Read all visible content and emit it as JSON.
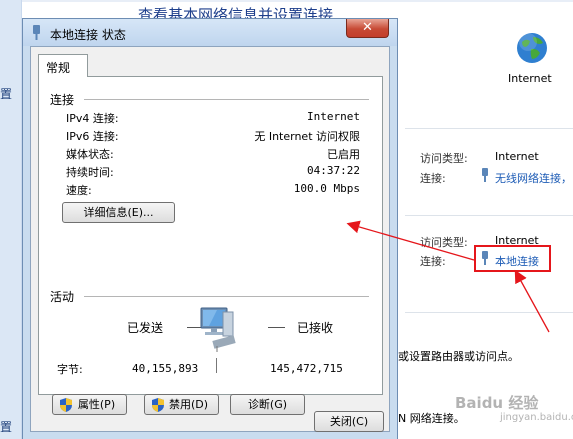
{
  "background": {
    "title": "查看基本网络信息并设置连接",
    "left_label": "置",
    "left_label2": "置",
    "internet_label": "Internet",
    "network1": {
      "access_type_label": "访问类型:",
      "access_type_value": "Internet",
      "connection_label": "连接:",
      "connection_value": "无线网络连接，"
    },
    "network2": {
      "access_type_label": "访问类型:",
      "access_type_value": "Internet",
      "connection_label": "连接:",
      "connection_value": "本地连接"
    },
    "bottom_text": "或设置路由器或访问点。",
    "bottom_text2": "N 网络连接。",
    "watermark": "Baidu 经验",
    "watermark_sub": "jingyan.baidu.com",
    "highlight_color": "#e5161b"
  },
  "dialog": {
    "title": "本地连接 状态",
    "close_glyph": "✕",
    "tab": "常规",
    "connection": {
      "group_label": "连接",
      "rows": [
        {
          "label": "IPv4 连接:",
          "value": "Internet"
        },
        {
          "label": "IPv6 连接:",
          "value": "无 Internet 访问权限"
        },
        {
          "label": "媒体状态:",
          "value": "已启用"
        },
        {
          "label": "持续时间:",
          "value": "04:37:22"
        },
        {
          "label": "速度:",
          "value": "100.0 Mbps"
        }
      ],
      "details_button": "详细信息(E)..."
    },
    "activity": {
      "group_label": "活动",
      "sent_label": "已发送",
      "received_label": "已接收",
      "bytes_label": "字节:",
      "sent_bytes": "40,155,893",
      "received_bytes": "145,472,715"
    },
    "buttons": {
      "properties": "属性(P)",
      "disable": "禁用(D)",
      "diagnose": "诊断(G)",
      "close": "关闭(C)"
    }
  }
}
